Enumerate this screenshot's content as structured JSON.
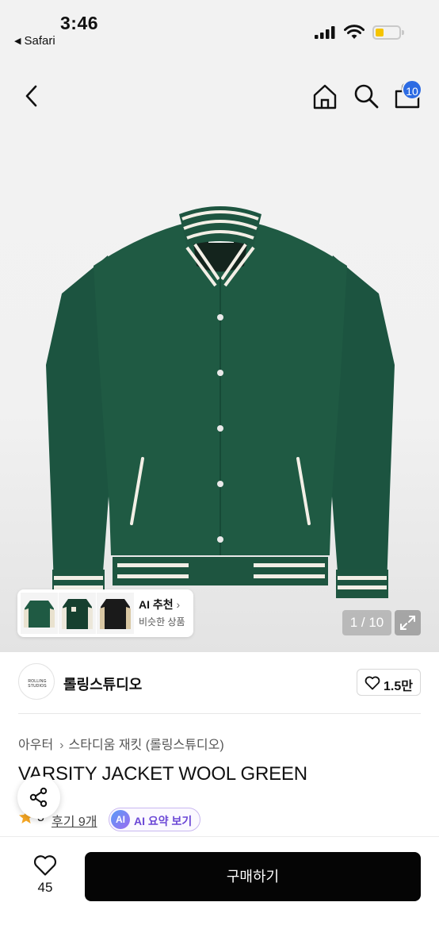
{
  "status_bar": {
    "time": "3:46",
    "back_app": "Safari",
    "icons": [
      "cellular-signal-icon",
      "wifi-icon",
      "battery-icon"
    ]
  },
  "top_nav": {
    "icons": [
      "chevron-left-icon",
      "home-icon",
      "search-icon",
      "shopping-bag-icon"
    ],
    "cart_badge": "10"
  },
  "gallery": {
    "counter": "1 / 10",
    "expand_icon": "expand-icon",
    "ai_recommend": {
      "title": "AI 추천",
      "subtitle": "비슷한 상품",
      "thumbnails": [
        "green-varsity-jacket-thumbnail",
        "green-varsity-jacket-thumbnail",
        "black-varsity-jacket-thumbnail"
      ]
    }
  },
  "brand": {
    "logo_text": "ROLLING STUDIOS",
    "name": "롤링스튜디오",
    "likes": "1.5만"
  },
  "breadcrumb": {
    "category": "아우터",
    "subcategory": "스타디움 재킷 (롤링스튜디오)"
  },
  "product": {
    "title": "VARSITY JACKET WOOL GREEN",
    "rating": "5",
    "reviews": "후기 9개",
    "ai_summary_badge": "AI",
    "ai_summary": "AI 요약 보기"
  },
  "bottom_bar": {
    "wish_count": "45",
    "buy_label": "구매하기"
  },
  "colors": {
    "jacket_green": "#1f5a43",
    "accent_blue": "#2c6be3",
    "buy_button": "#050505",
    "star": "#f5a623"
  }
}
